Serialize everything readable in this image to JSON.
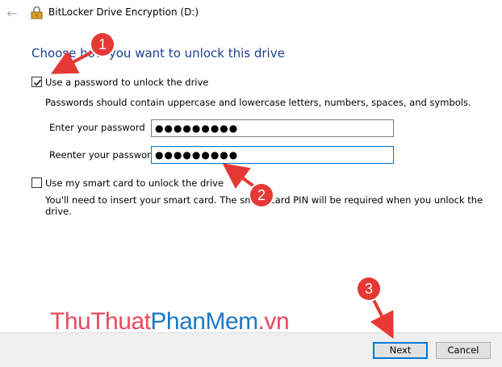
{
  "window": {
    "title": "BitLocker Drive Encryption (D:)"
  },
  "main": {
    "heading": "Choose how you want to unlock this drive",
    "password_option": {
      "label": "Use a password to unlock the drive",
      "checked": true,
      "description": "Passwords should contain uppercase and lowercase letters, numbers, spaces, and symbols.",
      "enter_label": "Enter your password",
      "enter_value": "●●●●●●●●●",
      "reenter_label": "Reenter your password",
      "reenter_value": "●●●●●●●●●"
    },
    "smartcard_option": {
      "label": "Use my smart card to unlock the drive",
      "checked": false,
      "description": "You'll need to insert your smart card. The smart card PIN will be required when you unlock the drive."
    }
  },
  "footer": {
    "next_label": "Next",
    "cancel_label": "Cancel"
  },
  "watermark": {
    "part1": "ThuThuat",
    "part2": "PhanMem",
    "part3": ".vn"
  },
  "annotations": {
    "marker1": "1",
    "marker2": "2",
    "marker3": "3",
    "color": "#e53935"
  },
  "colors": {
    "heading": "#1c3e8e",
    "focus": "#0078d7"
  }
}
